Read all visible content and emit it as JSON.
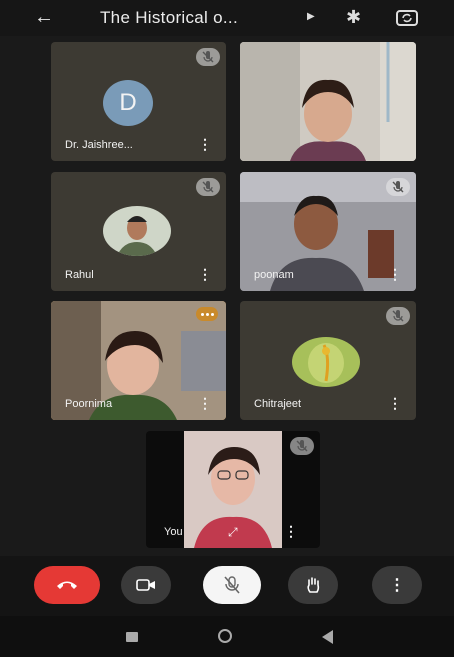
{
  "header": {
    "title": "The Historical o...",
    "back_icon": "back-arrow-icon",
    "caret_icon": "chevron-right-icon",
    "bluetooth_icon": "bluetooth-icon",
    "switch_camera_icon": "switch-camera-icon"
  },
  "participants": [
    {
      "name": "Dr. Jaishree...",
      "initial": "D",
      "muted": true
    },
    {
      "name": "",
      "muted": false
    },
    {
      "name": "Rahul",
      "muted": true
    },
    {
      "name": "poonam",
      "muted": true
    },
    {
      "name": "Poornima",
      "speaking": true
    },
    {
      "name": "Chitrajeet",
      "muted": true
    }
  ],
  "self_view": {
    "name": "You"
  },
  "controls": {
    "end_call_color": "#e53935",
    "items": [
      "end-call",
      "camera",
      "microphone",
      "raise-hand",
      "more"
    ]
  },
  "colors": {
    "tile_bg": "#3d3a33",
    "speaking_border": "#c98a2b",
    "accent_mic_bg": "#ffffff"
  }
}
